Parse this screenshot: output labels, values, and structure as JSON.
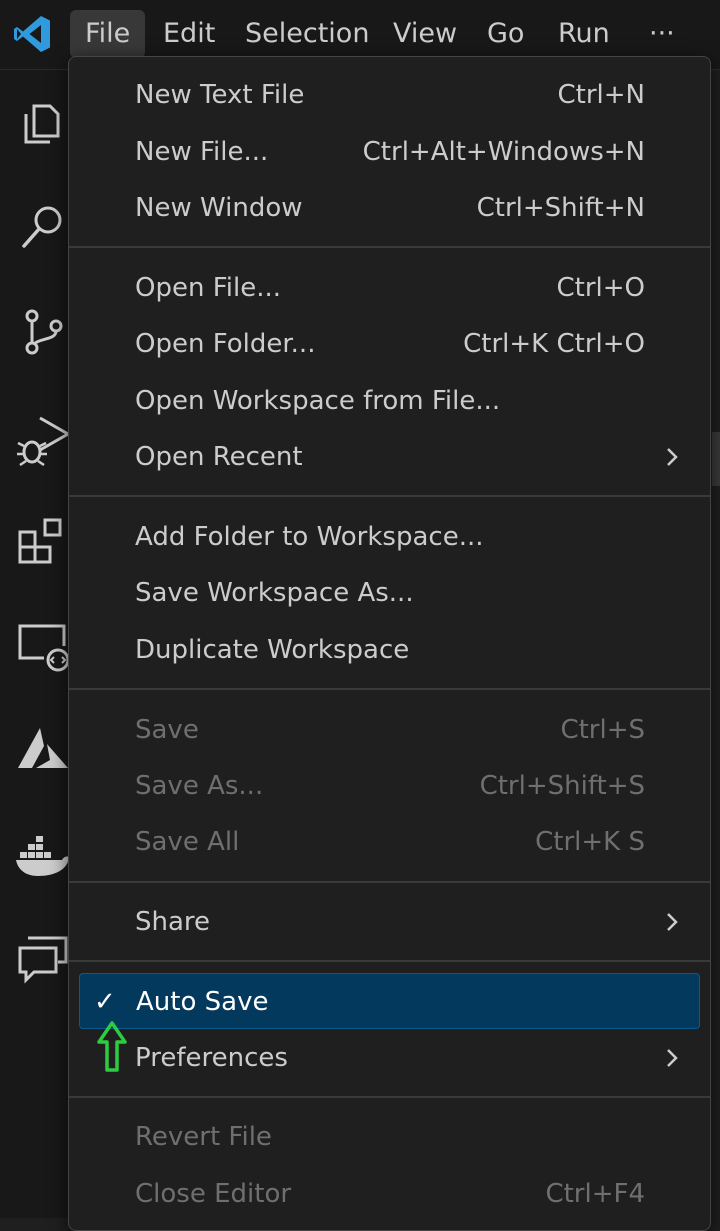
{
  "menubar": {
    "items": [
      "File",
      "Edit",
      "Selection",
      "View",
      "Go",
      "Run"
    ],
    "more": "···"
  },
  "activity_icons": [
    "explorer-icon",
    "search-icon",
    "source-control-icon",
    "run-debug-icon",
    "extensions-icon",
    "remote-explorer-icon",
    "azure-icon",
    "docker-icon",
    "chat-icon"
  ],
  "file_menu": {
    "groups": [
      [
        {
          "label": "New Text File",
          "shortcut": "Ctrl+N"
        },
        {
          "label": "New File...",
          "shortcut": "Ctrl+Alt+Windows+N"
        },
        {
          "label": "New Window",
          "shortcut": "Ctrl+Shift+N"
        }
      ],
      [
        {
          "label": "Open File...",
          "shortcut": "Ctrl+O"
        },
        {
          "label": "Open Folder...",
          "shortcut": "Ctrl+K Ctrl+O"
        },
        {
          "label": "Open Workspace from File...",
          "shortcut": ""
        },
        {
          "label": "Open Recent",
          "submenu": true
        }
      ],
      [
        {
          "label": "Add Folder to Workspace...",
          "shortcut": ""
        },
        {
          "label": "Save Workspace As...",
          "shortcut": ""
        },
        {
          "label": "Duplicate Workspace",
          "shortcut": ""
        }
      ],
      [
        {
          "label": "Save",
          "shortcut": "Ctrl+S",
          "disabled": true
        },
        {
          "label": "Save As...",
          "shortcut": "Ctrl+Shift+S",
          "disabled": true
        },
        {
          "label": "Save All",
          "shortcut": "Ctrl+K S",
          "disabled": true
        }
      ],
      [
        {
          "label": "Share",
          "submenu": true
        }
      ],
      [
        {
          "label": "Auto Save",
          "checked": true,
          "highlighted": true
        },
        {
          "label": "Preferences",
          "submenu": true
        }
      ],
      [
        {
          "label": "Revert File",
          "disabled": true
        },
        {
          "label": "Close Editor",
          "shortcut": "Ctrl+F4",
          "disabled": true
        }
      ]
    ]
  },
  "colors": {
    "accent_highlight": "#04395e",
    "annotation_arrow": "#2ecc40",
    "vscode_blue": "#2f9bde"
  }
}
